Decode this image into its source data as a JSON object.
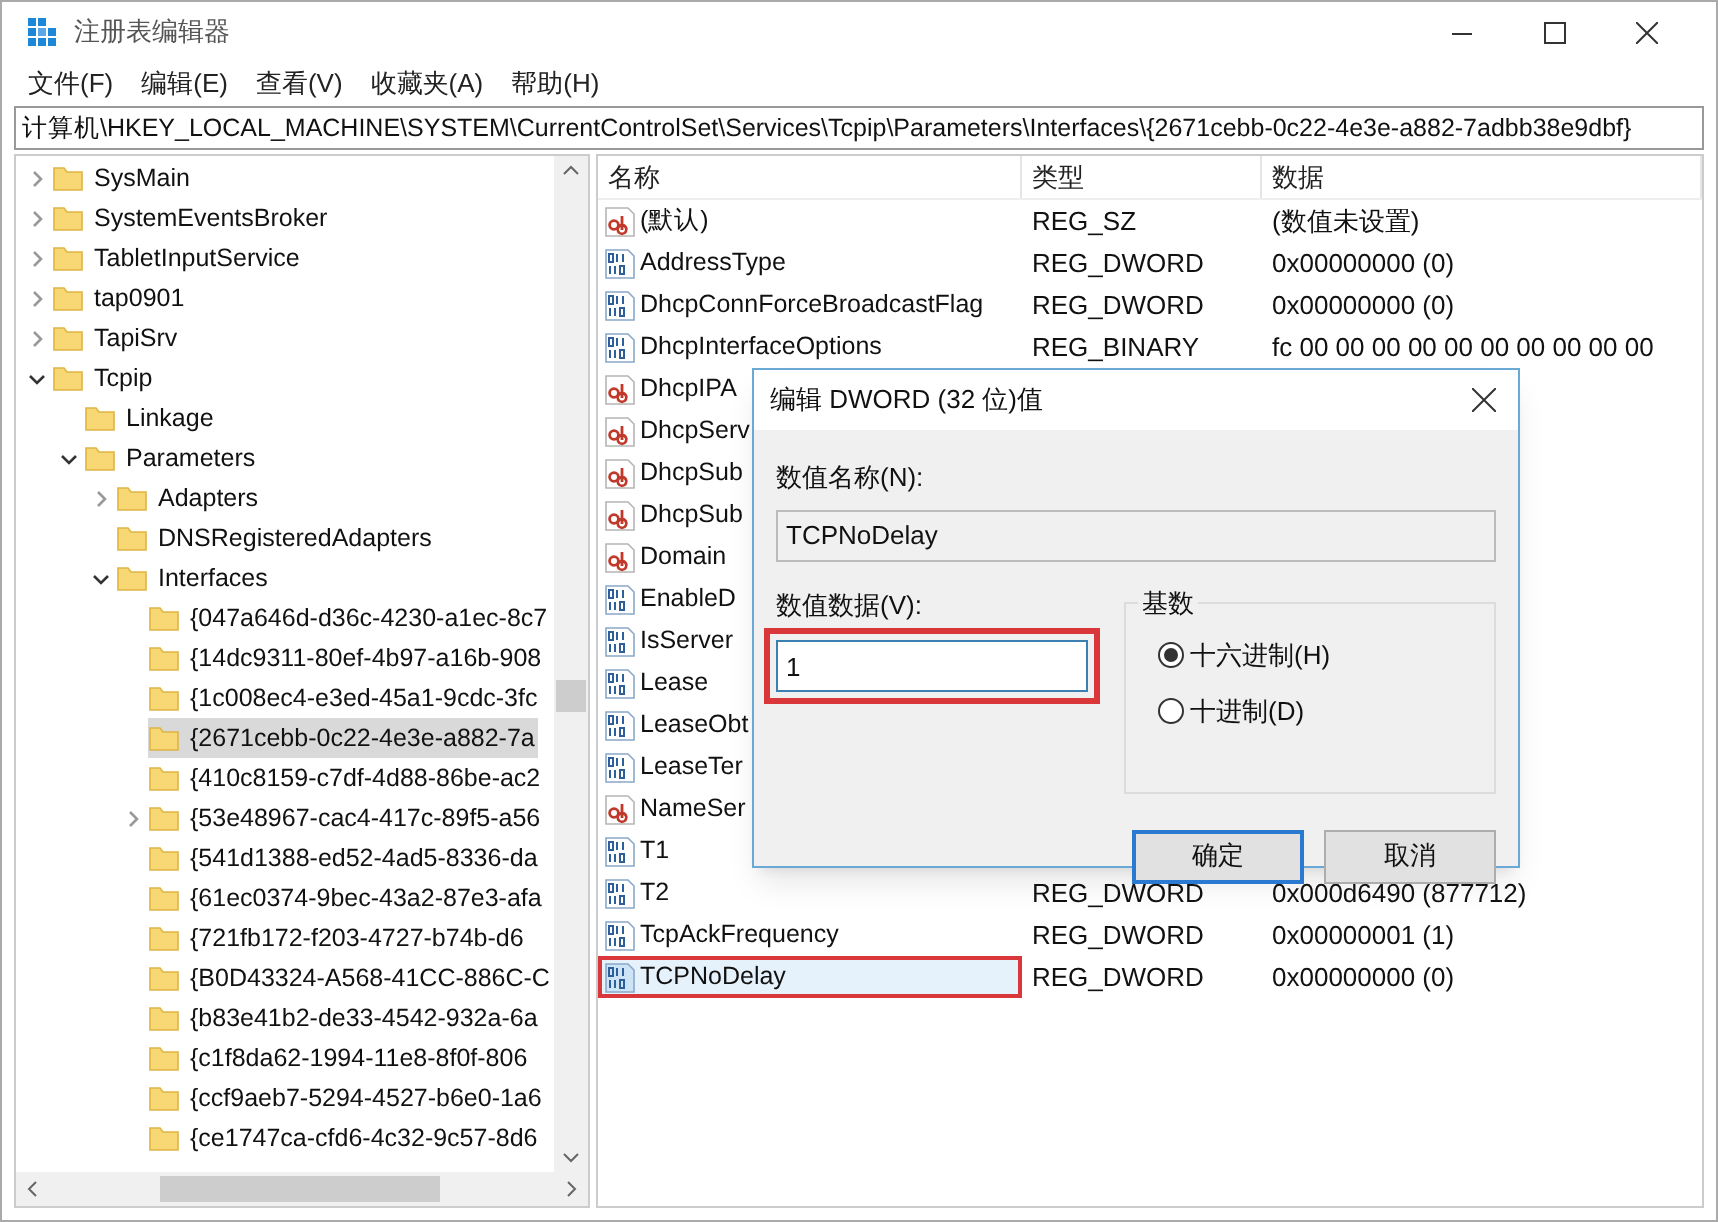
{
  "window": {
    "title": "注册表编辑器"
  },
  "menu": [
    "文件(F)",
    "编辑(E)",
    "查看(V)",
    "收藏夹(A)",
    "帮助(H)"
  ],
  "address": "计算机\\HKEY_LOCAL_MACHINE\\SYSTEM\\CurrentControlSet\\Services\\Tcpip\\Parameters\\Interfaces\\{2671cebb-0c22-4e3e-a882-7adbb38e9dbf}",
  "tree": [
    {
      "label": "SysMain",
      "kind": "branch",
      "expanded": false,
      "selected": false
    },
    {
      "label": "SystemEventsBroker",
      "kind": "branch",
      "expanded": false,
      "selected": false
    },
    {
      "label": "TabletInputService",
      "kind": "branch",
      "expanded": false,
      "selected": false
    },
    {
      "label": "tap0901",
      "kind": "branch",
      "expanded": false,
      "selected": false
    },
    {
      "label": "TapiSrv",
      "kind": "branch",
      "expanded": false,
      "selected": false
    },
    {
      "label": "Tcpip",
      "kind": "branch",
      "expanded": true,
      "selected": false,
      "children": [
        {
          "label": "Linkage",
          "kind": "leaf",
          "selected": false
        },
        {
          "label": "Parameters",
          "kind": "branch",
          "expanded": true,
          "selected": false,
          "children": [
            {
              "label": "Adapters",
              "kind": "branch",
              "expanded": false,
              "selected": false
            },
            {
              "label": "DNSRegisteredAdapters",
              "kind": "leaf",
              "selected": false
            },
            {
              "label": "Interfaces",
              "kind": "branch",
              "expanded": true,
              "selected": false,
              "children": [
                {
                  "label": "{047a646d-d36c-4230-a1ec-8c7",
                  "kind": "leaf",
                  "selected": false
                },
                {
                  "label": "{14dc9311-80ef-4b97-a16b-908",
                  "kind": "leaf",
                  "selected": false
                },
                {
                  "label": "{1c008ec4-e3ed-45a1-9cdc-3fc",
                  "kind": "leaf",
                  "selected": false
                },
                {
                  "label": "{2671cebb-0c22-4e3e-a882-7a",
                  "kind": "leaf",
                  "selected": true
                },
                {
                  "label": "{410c8159-c7df-4d88-86be-ac2",
                  "kind": "leaf",
                  "selected": false
                },
                {
                  "label": "{53e48967-cac4-417c-89f5-a56",
                  "kind": "branch",
                  "expanded": false,
                  "selected": false
                },
                {
                  "label": "{541d1388-ed52-4ad5-8336-da",
                  "kind": "leaf",
                  "selected": false
                },
                {
                  "label": "{61ec0374-9bec-43a2-87e3-afa",
                  "kind": "leaf",
                  "selected": false
                },
                {
                  "label": "{721fb172-f203-4727-b74b-d6",
                  "kind": "leaf",
                  "selected": false
                },
                {
                  "label": "{B0D43324-A568-41CC-886C-C",
                  "kind": "leaf",
                  "selected": false
                },
                {
                  "label": "{b83e41b2-de33-4542-932a-6a",
                  "kind": "leaf",
                  "selected": false
                },
                {
                  "label": "{c1f8da62-1994-11e8-8f0f-806",
                  "kind": "leaf",
                  "selected": false
                },
                {
                  "label": "{ccf9aeb7-5294-4527-b6e0-1a6",
                  "kind": "leaf",
                  "selected": false
                },
                {
                  "label": "{ce1747ca-cfd6-4c32-9c57-8d6",
                  "kind": "leaf",
                  "selected": false
                }
              ]
            }
          ]
        }
      ]
    }
  ],
  "table": {
    "columns": [
      "名称",
      "类型",
      "数据"
    ],
    "rows": [
      {
        "name": "(默认)",
        "kind": "string",
        "type": "REG_SZ",
        "data": "(数值未设置)",
        "selected": false,
        "highlighted": false
      },
      {
        "name": "AddressType",
        "kind": "binary",
        "type": "REG_DWORD",
        "data": "0x00000000 (0)",
        "selected": false,
        "highlighted": false
      },
      {
        "name": "DhcpConnForceBroadcastFlag",
        "kind": "binary",
        "type": "REG_DWORD",
        "data": "0x00000000 (0)",
        "selected": false,
        "highlighted": false
      },
      {
        "name": "DhcpInterfaceOptions",
        "kind": "binary",
        "type": "REG_BINARY",
        "data": "fc 00 00 00 00 00 00 00 00 00 00",
        "selected": false,
        "highlighted": false
      },
      {
        "name": "DhcpIPA",
        "kind": "string",
        "selected": false,
        "highlighted": false
      },
      {
        "name": "DhcpServ",
        "kind": "string",
        "selected": false,
        "highlighted": false
      },
      {
        "name": "DhcpSub",
        "kind": "string",
        "selected": false,
        "highlighted": false
      },
      {
        "name": "DhcpSub",
        "kind": "string",
        "selected": false,
        "highlighted": false
      },
      {
        "name": "Domain",
        "kind": "string",
        "selected": false,
        "highlighted": false
      },
      {
        "name": "EnableD",
        "kind": "binary",
        "selected": false,
        "highlighted": false
      },
      {
        "name": "IsServer",
        "kind": "binary",
        "selected": false,
        "highlighted": false
      },
      {
        "name": "Lease",
        "kind": "binary",
        "selected": false,
        "highlighted": false
      },
      {
        "name": "LeaseObt",
        "kind": "binary",
        "selected": false,
        "highlighted": false
      },
      {
        "name": "LeaseTer",
        "kind": "binary",
        "selected": false,
        "highlighted": false
      },
      {
        "name": "NameSer",
        "kind": "string",
        "selected": false,
        "highlighted": false
      },
      {
        "name": "T1",
        "kind": "binary",
        "selected": false,
        "highlighted": false
      },
      {
        "name": "T2",
        "kind": "binary",
        "type": "REG_DWORD",
        "data": "0x000d6490 (877712)",
        "selected": false,
        "highlighted": false
      },
      {
        "name": "TcpAckFrequency",
        "kind": "binary",
        "type": "REG_DWORD",
        "data": "0x00000001 (1)",
        "selected": false,
        "highlighted": false
      },
      {
        "name": "TCPNoDelay",
        "kind": "binary",
        "type": "REG_DWORD",
        "data": "0x00000000 (0)",
        "selected": true,
        "highlighted": true
      }
    ]
  },
  "dialog": {
    "title": "编辑 DWORD (32 位)值",
    "name_label": "数值名称(N):",
    "name_value": "TCPNoDelay",
    "data_label": "数值数据(V):",
    "data_value": "1",
    "data_highlighted": true,
    "base": {
      "title": "基数",
      "options": [
        {
          "label": "十六进制(H)",
          "selected": true
        },
        {
          "label": "十进制(D)",
          "selected": false
        }
      ]
    },
    "buttons": [
      {
        "label": "确定",
        "default": true
      },
      {
        "label": "取消",
        "default": false
      }
    ]
  }
}
